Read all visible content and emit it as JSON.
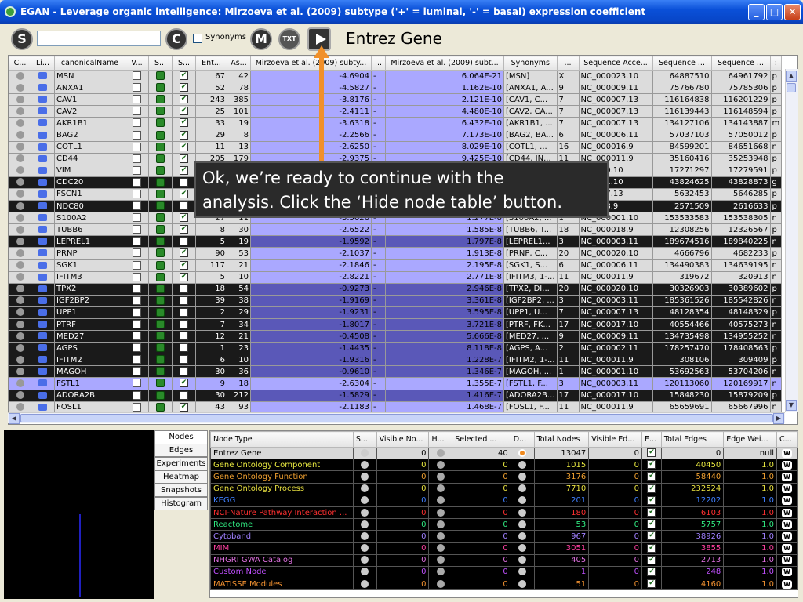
{
  "window": {
    "title": "EGAN - Leverage organic intelligence: Mirzoeva et al. (2009) subtype ('+' = luminal, '-' = basal) expression coefficient",
    "min": "_",
    "max": "□",
    "close": "✕"
  },
  "toolbar": {
    "s_btn": "S",
    "c_btn": "C",
    "synonyms_label": "Synonyms",
    "m_btn": "M",
    "tx_btn": "TXT",
    "node_type_title": "Entrez Gene"
  },
  "node_table": {
    "headers": [
      "C...",
      "Li...",
      "canonicalName",
      "V...",
      "S...",
      "S...",
      "Ent...",
      "As...",
      "Mirzoeva et al. (2009) subty...",
      "...",
      "Mirzoeva et al. (2009) subt...",
      "Synonyms",
      "...",
      "Sequence Acce...",
      "Sequence ...",
      "Sequence ...",
      ":"
    ],
    "rows": [
      {
        "name": "MSN",
        "ent": "67",
        "as": "42",
        "mz": "-4.6904",
        "sg": "-",
        "p": "6.064E-21",
        "syn": "[MSN]",
        "chr": "X",
        "acc": "NC_000023.10",
        "s1": "64887510",
        "s2": "64961792",
        "x": "p",
        "shade": "light",
        "sel": false,
        "chk": true
      },
      {
        "name": "ANXA1",
        "ent": "52",
        "as": "78",
        "mz": "-4.5827",
        "sg": "-",
        "p": "1.162E-10",
        "syn": "[ANXA1, A...",
        "chr": "9",
        "acc": "NC_000009.11",
        "s1": "75766780",
        "s2": "75785306",
        "x": "p",
        "shade": "light",
        "sel": false,
        "chk": true
      },
      {
        "name": "CAV1",
        "ent": "243",
        "as": "385",
        "mz": "-3.8176",
        "sg": "-",
        "p": "2.121E-10",
        "syn": "[CAV1, C...",
        "chr": "7",
        "acc": "NC_000007.13",
        "s1": "116164838",
        "s2": "116201229",
        "x": "p",
        "shade": "light",
        "sel": false,
        "chk": true
      },
      {
        "name": "CAV2",
        "ent": "25",
        "as": "101",
        "mz": "-2.4111",
        "sg": "-",
        "p": "4.480E-10",
        "syn": "[CAV2, CA...",
        "chr": "7",
        "acc": "NC_000007.13",
        "s1": "116139443",
        "s2": "116148594",
        "x": "p",
        "shade": "light",
        "sel": false,
        "chk": true
      },
      {
        "name": "AKR1B1",
        "ent": "33",
        "as": "19",
        "mz": "-3.6318",
        "sg": "-",
        "p": "6.432E-10",
        "syn": "[AKR1B1, ...",
        "chr": "7",
        "acc": "NC_000007.13",
        "s1": "134127106",
        "s2": "134143887",
        "x": "m",
        "shade": "light",
        "sel": false,
        "chk": true
      },
      {
        "name": "BAG2",
        "ent": "29",
        "as": "8",
        "mz": "-2.2566",
        "sg": "-",
        "p": "7.173E-10",
        "syn": "[BAG2, BA...",
        "chr": "6",
        "acc": "NC_000006.11",
        "s1": "57037103",
        "s2": "57050012",
        "x": "p",
        "shade": "light",
        "sel": false,
        "chk": true
      },
      {
        "name": "COTL1",
        "ent": "11",
        "as": "13",
        "mz": "-2.6250",
        "sg": "-",
        "p": "8.029E-10",
        "syn": "[COTL1, ...",
        "chr": "16",
        "acc": "NC_000016.9",
        "s1": "84599201",
        "s2": "84651668",
        "x": "n",
        "shade": "light",
        "sel": false,
        "chk": true
      },
      {
        "name": "CD44",
        "ent": "205",
        "as": "179",
        "mz": "-2.9375",
        "sg": "-",
        "p": "9.425E-10",
        "syn": "[CD44, IN...",
        "chr": "11",
        "acc": "NC_000011.9",
        "s1": "35160416",
        "s2": "35253948",
        "x": "p",
        "shade": "light",
        "sel": false,
        "chk": true
      },
      {
        "name": "VIM",
        "ent": "",
        "as": "",
        "mz": "",
        "sg": "",
        "p": "",
        "syn": "",
        "chr": "",
        "acc": "000010.10",
        "s1": "17271297",
        "s2": "17279591",
        "x": "p",
        "shade": "light",
        "sel": false,
        "chk": true
      },
      {
        "name": "CDC20",
        "ent": "",
        "as": "",
        "mz": "",
        "sg": "",
        "p": "",
        "syn": "",
        "chr": "",
        "acc": "000001.10",
        "s1": "43824625",
        "s2": "43828873",
        "x": "g",
        "shade": "dark",
        "sel": false,
        "chk": false
      },
      {
        "name": "FSCN1",
        "ent": "",
        "as": "",
        "mz": "",
        "sg": "",
        "p": "",
        "syn": "",
        "chr": "",
        "acc": "000007.13",
        "s1": "5632453",
        "s2": "5646285",
        "x": "p",
        "shade": "light",
        "sel": false,
        "chk": true
      },
      {
        "name": "NDC80",
        "ent": "",
        "as": "",
        "mz": "",
        "sg": "",
        "p": "",
        "syn": "",
        "chr": "",
        "acc": "000018.9",
        "s1": "2571509",
        "s2": "2616633",
        "x": "p",
        "shade": "dark",
        "sel": false,
        "chk": false
      },
      {
        "name": "S100A2",
        "ent": "27",
        "as": "11",
        "mz": "-3.5626",
        "sg": "-",
        "p": "1.277E-8",
        "syn": "[S100A2, ...",
        "chr": "1",
        "acc": "NC_000001.10",
        "s1": "153533583",
        "s2": "153538305",
        "x": "n",
        "shade": "light",
        "sel": false,
        "chk": true
      },
      {
        "name": "TUBB6",
        "ent": "8",
        "as": "30",
        "mz": "-2.6522",
        "sg": "-",
        "p": "1.585E-8",
        "syn": "[TUBB6, T...",
        "chr": "18",
        "acc": "NC_000018.9",
        "s1": "12308256",
        "s2": "12326567",
        "x": "p",
        "shade": "light",
        "sel": false,
        "chk": true
      },
      {
        "name": "LEPREL1",
        "ent": "5",
        "as": "19",
        "mz": "-1.9592",
        "sg": "-",
        "p": "1.797E-8",
        "syn": "[LEPREL1...",
        "chr": "3",
        "acc": "NC_000003.11",
        "s1": "189674516",
        "s2": "189840225",
        "x": "n",
        "shade": "dark",
        "sel": false,
        "chk": false
      },
      {
        "name": "PRNP",
        "ent": "90",
        "as": "53",
        "mz": "-2.1037",
        "sg": "-",
        "p": "1.913E-8",
        "syn": "[PRNP, C...",
        "chr": "20",
        "acc": "NC_000020.10",
        "s1": "4666796",
        "s2": "4682233",
        "x": "p",
        "shade": "light",
        "sel": false,
        "chk": true
      },
      {
        "name": "SGK1",
        "ent": "117",
        "as": "21",
        "mz": "-2.1846",
        "sg": "-",
        "p": "2.195E-8",
        "syn": "[SGK1, S...",
        "chr": "6",
        "acc": "NC_000006.11",
        "s1": "134490383",
        "s2": "134639195",
        "x": "n",
        "shade": "light",
        "sel": false,
        "chk": true
      },
      {
        "name": "IFITM3",
        "ent": "5",
        "as": "10",
        "mz": "-2.8221",
        "sg": "-",
        "p": "2.771E-8",
        "syn": "[IFITM3, 1-...",
        "chr": "11",
        "acc": "NC_000011.9",
        "s1": "319672",
        "s2": "320913",
        "x": "n",
        "shade": "light",
        "sel": false,
        "chk": true
      },
      {
        "name": "TPX2",
        "ent": "18",
        "as": "54",
        "mz": "-0.9273",
        "sg": "-",
        "p": "2.946E-8",
        "syn": "[TPX2, DI...",
        "chr": "20",
        "acc": "NC_000020.10",
        "s1": "30326903",
        "s2": "30389602",
        "x": "p",
        "shade": "dark",
        "sel": false,
        "chk": false
      },
      {
        "name": "IGF2BP2",
        "ent": "39",
        "as": "38",
        "mz": "-1.9169",
        "sg": "-",
        "p": "3.361E-8",
        "syn": "[IGF2BP2, ...",
        "chr": "3",
        "acc": "NC_000003.11",
        "s1": "185361526",
        "s2": "185542826",
        "x": "n",
        "shade": "dark",
        "sel": false,
        "chk": false
      },
      {
        "name": "UPP1",
        "ent": "2",
        "as": "29",
        "mz": "-1.9231",
        "sg": "-",
        "p": "3.595E-8",
        "syn": "[UPP1, U...",
        "chr": "7",
        "acc": "NC_000007.13",
        "s1": "48128354",
        "s2": "48148329",
        "x": "p",
        "shade": "dark",
        "sel": false,
        "chk": false
      },
      {
        "name": "PTRF",
        "ent": "7",
        "as": "34",
        "mz": "-1.8017",
        "sg": "-",
        "p": "3.721E-8",
        "syn": "[PTRF, FK...",
        "chr": "17",
        "acc": "NC_000017.10",
        "s1": "40554466",
        "s2": "40575273",
        "x": "n",
        "shade": "dark",
        "sel": false,
        "chk": false
      },
      {
        "name": "MED27",
        "ent": "12",
        "as": "21",
        "mz": "-0.4508",
        "sg": "-",
        "p": "5.666E-8",
        "syn": "[MED27, ...",
        "chr": "9",
        "acc": "NC_000009.11",
        "s1": "134735498",
        "s2": "134955252",
        "x": "n",
        "shade": "dark",
        "sel": false,
        "chk": false
      },
      {
        "name": "AGPS",
        "ent": "1",
        "as": "23",
        "mz": "-1.4435",
        "sg": "-",
        "p": "8.118E-8",
        "syn": "[AGPS, A...",
        "chr": "2",
        "acc": "NC_000002.11",
        "s1": "178257470",
        "s2": "178408563",
        "x": "p",
        "shade": "dark",
        "sel": false,
        "chk": false
      },
      {
        "name": "IFITM2",
        "ent": "6",
        "as": "10",
        "mz": "-1.9316",
        "sg": "-",
        "p": "1.228E-7",
        "syn": "[IFITM2, 1-...",
        "chr": "11",
        "acc": "NC_000011.9",
        "s1": "308106",
        "s2": "309409",
        "x": "p",
        "shade": "dark",
        "sel": false,
        "chk": false
      },
      {
        "name": "MAGOH",
        "ent": "30",
        "as": "36",
        "mz": "-0.9610",
        "sg": "-",
        "p": "1.346E-7",
        "syn": "[MAGOH, ...",
        "chr": "1",
        "acc": "NC_000001.10",
        "s1": "53692563",
        "s2": "53704206",
        "x": "n",
        "shade": "dark",
        "sel": false,
        "chk": false
      },
      {
        "name": "FSTL1",
        "ent": "9",
        "as": "18",
        "mz": "-2.6304",
        "sg": "-",
        "p": "1.355E-7",
        "syn": "[FSTL1, F...",
        "chr": "3",
        "acc": "NC_000003.11",
        "s1": "120113060",
        "s2": "120169917",
        "x": "n",
        "shade": "light",
        "sel": true,
        "chk": true
      },
      {
        "name": "ADORA2B",
        "ent": "30",
        "as": "212",
        "mz": "-1.5829",
        "sg": "-",
        "p": "1.416E-7",
        "syn": "[ADORA2B...",
        "chr": "17",
        "acc": "NC_000017.10",
        "s1": "15848230",
        "s2": "15879209",
        "x": "p",
        "shade": "dark",
        "sel": false,
        "chk": false
      },
      {
        "name": "FOSL1",
        "ent": "43",
        "as": "93",
        "mz": "-2.1183",
        "sg": "-",
        "p": "1.468E-7",
        "syn": "[FOSL1, F...",
        "chr": "11",
        "acc": "NC_000011.9",
        "s1": "65659691",
        "s2": "65667996",
        "x": "n",
        "shade": "light",
        "sel": false,
        "chk": true
      }
    ]
  },
  "side_tabs": [
    "Nodes",
    "Edges",
    "Experiments",
    "Heatmap",
    "Snapshots",
    "Histogram"
  ],
  "type_table": {
    "headers": [
      "Node Type",
      "S...",
      "Visible No...",
      "H...",
      "Selected ...",
      "D...",
      "Total Nodes",
      "Visible Ed...",
      "E...",
      "Total Edges",
      "Edge Wei...",
      "C..."
    ],
    "rows": [
      {
        "name": "Entrez Gene",
        "vis": "0",
        "sel": "40",
        "total": "13047",
        "ved": "0",
        "tedges": "0",
        "w": "null",
        "color": "#000000"
      },
      {
        "name": "Gene Ontology Component",
        "vis": "0",
        "sel": "0",
        "total": "1015",
        "ved": "0",
        "tedges": "40450",
        "w": "1.0",
        "color": "#e8e840"
      },
      {
        "name": "Gene Ontology Function",
        "vis": "0",
        "sel": "0",
        "total": "3176",
        "ved": "0",
        "tedges": "58440",
        "w": "1.0",
        "color": "#f0a030"
      },
      {
        "name": "Gene Ontology Process",
        "vis": "0",
        "sel": "0",
        "total": "7710",
        "ved": "0",
        "tedges": "232524",
        "w": "1.0",
        "color": "#e8e040"
      },
      {
        "name": "KEGG",
        "vis": "0",
        "sel": "0",
        "total": "201",
        "ved": "0",
        "tedges": "12202",
        "w": "1.0",
        "color": "#4080ff"
      },
      {
        "name": "NCI-Nature Pathway Interaction ...",
        "vis": "0",
        "sel": "0",
        "total": "180",
        "ved": "0",
        "tedges": "6103",
        "w": "1.0",
        "color": "#ff3030"
      },
      {
        "name": "Reactome",
        "vis": "0",
        "sel": "0",
        "total": "53",
        "ved": "0",
        "tedges": "5757",
        "w": "1.0",
        "color": "#30e880"
      },
      {
        "name": "Cytoband",
        "vis": "0",
        "sel": "0",
        "total": "967",
        "ved": "0",
        "tedges": "38926",
        "w": "1.0",
        "color": "#a080ff"
      },
      {
        "name": "MIM",
        "vis": "0",
        "sel": "0",
        "total": "3051",
        "ved": "0",
        "tedges": "3855",
        "w": "1.0",
        "color": "#ff40a0"
      },
      {
        "name": "NHGRI GWA Catalog",
        "vis": "0",
        "sel": "0",
        "total": "405",
        "ved": "0",
        "tedges": "2713",
        "w": "1.0",
        "color": "#e070e0"
      },
      {
        "name": "Custom Node",
        "vis": "0",
        "sel": "0",
        "total": "1",
        "ved": "0",
        "tedges": "248",
        "w": "1.0",
        "color": "#c050ff"
      },
      {
        "name": "MATISSE Modules",
        "vis": "0",
        "sel": "0",
        "total": "51",
        "ved": "0",
        "tedges": "4160",
        "w": "1.0",
        "color": "#f09030"
      }
    ]
  },
  "callout": {
    "line1": "Ok, we’re ready to continue with the",
    "line2": "analysis.  Click the ‘Hide node table’ button."
  },
  "colors": {
    "accent_orange": "#f0902a",
    "title_blue": "#0a50d8",
    "selection_purple": "#aaa8ff"
  }
}
